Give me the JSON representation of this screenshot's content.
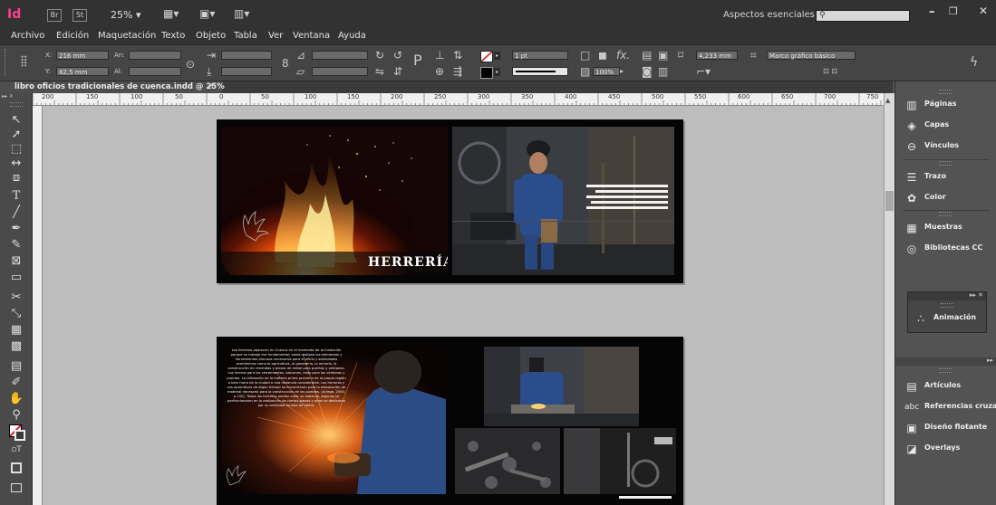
{
  "app": {
    "logo": "Id",
    "bridge_label": "Br",
    "stock_label": "St",
    "zoom": "25%",
    "workspace": "Aspectos esenciales",
    "search_placeholder": ""
  },
  "menu": [
    "Archivo",
    "Edición",
    "Maquetación",
    "Texto",
    "Objeto",
    "Tabla",
    "Ver",
    "Ventana",
    "Ayuda"
  ],
  "control": {
    "x_label": "X:",
    "x_value": "216 mm",
    "y_label": "Y:",
    "y_value": "82,5 mm",
    "w_label": "An:",
    "h_label": "Al:",
    "stroke_weight": "1 pt",
    "scale_percent": "100%",
    "gap_value": "4,233 mm",
    "frame_style": "Marco gráfico básico"
  },
  "document_tab": {
    "title": "libro oficios tradicionales de cuenca.indd @ 25%",
    "close": "×"
  },
  "ruler_top": [
    "200",
    "150",
    "100",
    "50",
    "0",
    "50",
    "100",
    "150",
    "200",
    "250",
    "300",
    "350",
    "400",
    "450",
    "500",
    "550",
    "600",
    "650",
    "700",
    "750"
  ],
  "panels": {
    "group1": [
      "Páginas",
      "Capas",
      "Vínculos"
    ],
    "group2": [
      "Trazo",
      "Color"
    ],
    "group3": [
      "Muestras",
      "Bibliotecas CC"
    ],
    "floating": "Animación",
    "group4": [
      "Artículos",
      "Referencias cruzadas",
      "Diseño flotante",
      "Overlays"
    ]
  },
  "spread1": {
    "title": "HERRERÍA"
  },
  "spread2": {
    "body_text": "Los herreros aparecen en Cuenca en el momento de la fundación porque su trabajo era fundamental; estos realizan los elementos y herramientas precisos necesarios para el oficio y actividades económicas como la agricultura, la ganadería, la minería, la construcción de viviendas y piezas de metal para puertas y ventanas. Los hierros para los cerramientos, balcones, rejas para las ventanas y puertas. La utilización de la materia prima proviene de la propia región o bien fuera de la ciudad a una distancia considerable. Los herreros y sus aprendices de algún tiempo se encontraron para la elaboración de material necesario para la construcción de los pueblos. (Artega, 2000, p.150). Todos los herreros podían crear su material, algunos se perfeccionaron en la realización de ciertas piezas y otros se dedicaron por su actividad forjada de hierro."
  }
}
